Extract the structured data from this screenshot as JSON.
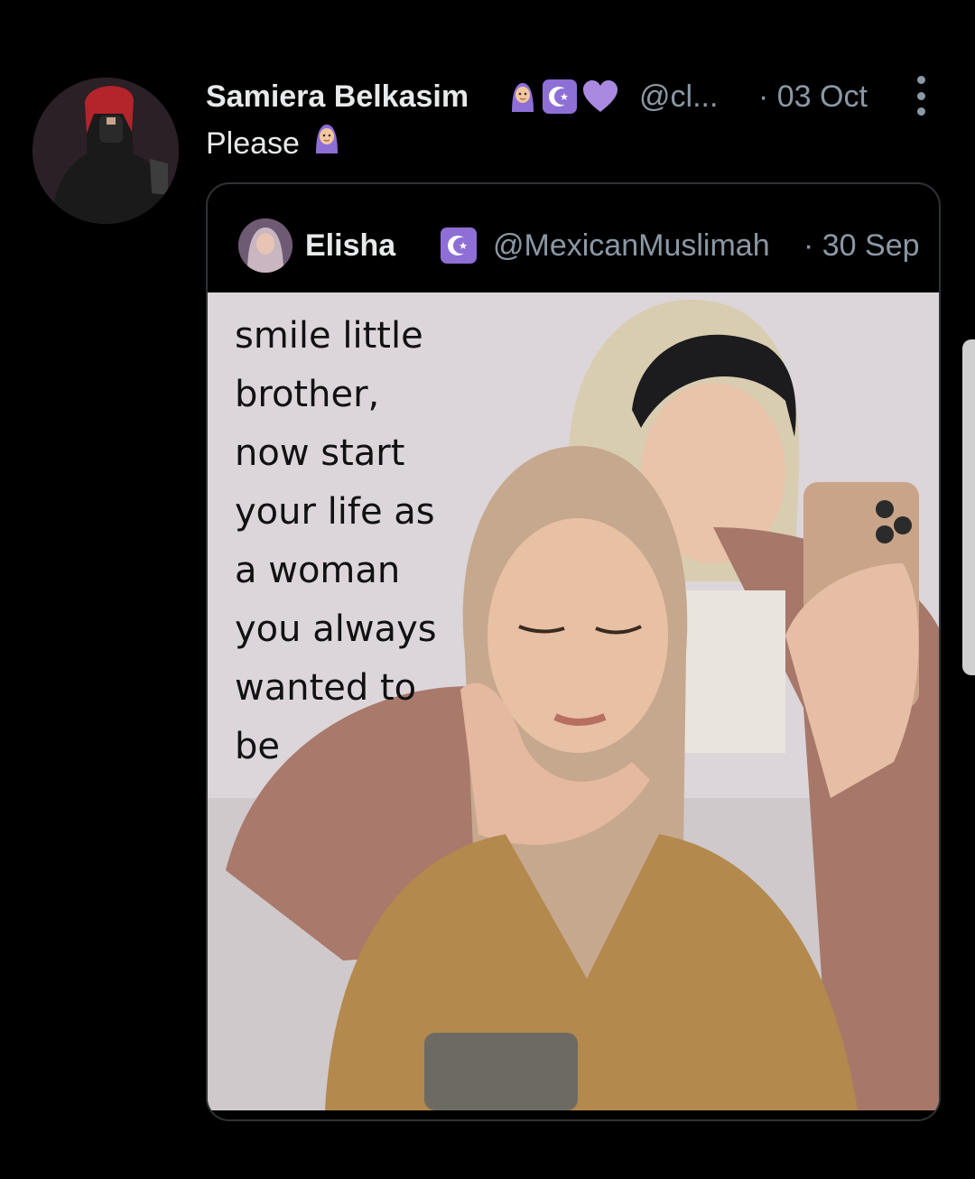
{
  "tweet": {
    "author_name": "Samiera Belkasim",
    "handle": "@cl...",
    "dot_date": "· 03 Oct",
    "text": "Please",
    "badges": [
      "hijab-woman-emoji",
      "crescent-star-badge",
      "purple-heart-emoji"
    ]
  },
  "quoted_tweet": {
    "author_name": "Elisha",
    "handle": "@MexicanMuslimah",
    "dot_date": "· 30 Sep",
    "media_caption": "smile little\nbrother,\nnow start\nyour life as\na woman\nyou always\nwanted to\nbe"
  },
  "colors": {
    "background": "#000000",
    "text_primary": "#e7e9ea",
    "text_secondary": "#8b98a5",
    "border": "#2f3336",
    "badge_purple": "#8e6fd6"
  }
}
